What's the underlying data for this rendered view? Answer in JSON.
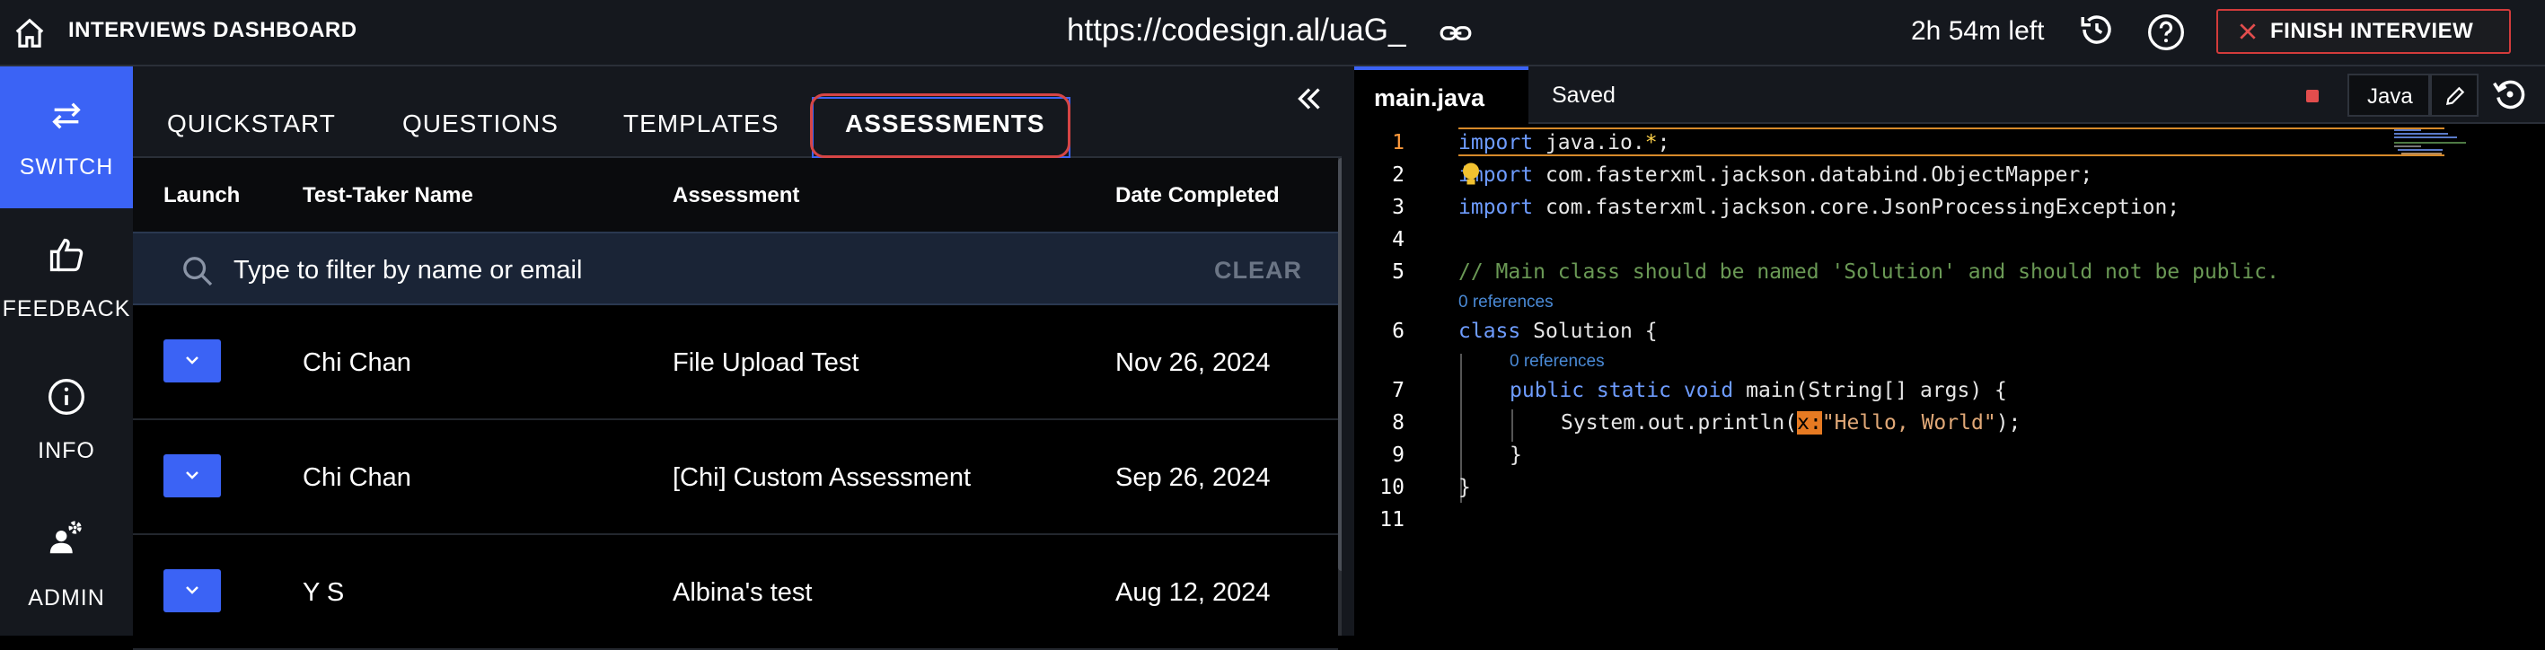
{
  "topbar": {
    "title": "INTERVIEWS DASHBOARD",
    "url": "https://codesign.al/uaG_",
    "timer": "2h 54m left",
    "finish_label": "FINISH INTERVIEW",
    "colors": {
      "finish_border": "#d23b3b",
      "bg": "#15181e"
    }
  },
  "leftnav": {
    "items": [
      {
        "label": "SWITCH",
        "icon": "switch-arrows-icon",
        "active": true
      },
      {
        "label": "FEEDBACK",
        "icon": "thumbs-up-icon",
        "active": false
      },
      {
        "label": "INFO",
        "icon": "info-icon",
        "active": false
      },
      {
        "label": "ADMIN",
        "icon": "admin-gear-user-icon",
        "active": false
      }
    ],
    "accent": "#3b63f5"
  },
  "center": {
    "tabs": [
      {
        "label": "QUICKSTART"
      },
      {
        "label": "QUESTIONS"
      },
      {
        "label": "TEMPLATES"
      },
      {
        "label": "ASSESSMENTS",
        "active": true
      }
    ],
    "columns": [
      "Launch",
      "Test-Taker Name",
      "Assessment",
      "Date Completed"
    ],
    "filter": {
      "placeholder": "Type to filter by name or email",
      "value": "",
      "clear_label": "CLEAR"
    },
    "rows": [
      {
        "name": "Chi Chan",
        "assessment": "File Upload Test",
        "date": "Nov 26, 2024"
      },
      {
        "name": "Chi Chan",
        "assessment": "[Chi] Custom Assessment",
        "date": "Sep 26, 2024"
      },
      {
        "name": "Y S",
        "assessment": "Albina's test",
        "date": "Aug 12, 2024"
      }
    ]
  },
  "editor": {
    "file_tab": "main.java",
    "status": "Saved",
    "language": "Java",
    "line_numbers": [
      "1",
      "2",
      "3",
      "4",
      "5",
      "6",
      "7",
      "8",
      "9",
      "10",
      "11"
    ],
    "codelens": [
      "0 references",
      "0 references"
    ],
    "code": {
      "l1_kw": "import",
      "l1_rest": " java.io.",
      "l1_star": "*",
      "l1_end": ";",
      "l2_kw": "import",
      "l2_rest": " com.fasterxml.jackson.databind.ObjectMapper;",
      "l3_kw": "import",
      "l3_rest": " com.fasterxml.jackson.core.JsonProcessingException;",
      "l5": "// Main class should be named 'Solution' and should not be public.",
      "l6_kw": "class",
      "l6_rest": " Solution {",
      "l7_kw": "public static void",
      "l7_rest": " main(String[] args) {",
      "l8_pre": "System.out.println(",
      "l8_hint": "x:",
      "l8_str": "\"Hello, World\"",
      "l8_end": ");",
      "l9": "}",
      "l10": "}"
    }
  }
}
